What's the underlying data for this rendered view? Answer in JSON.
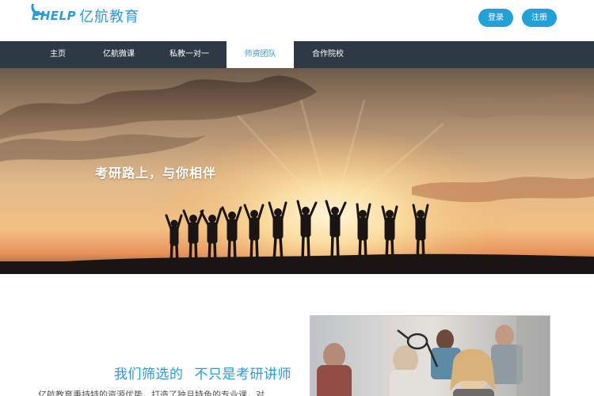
{
  "header": {
    "logo_mark": "EHELP",
    "logo_text": "亿航教育",
    "login_label": "登录",
    "register_label": "注册"
  },
  "nav": {
    "items": [
      {
        "label": "主页"
      },
      {
        "label": "亿航微课"
      },
      {
        "label": "私教一对一"
      },
      {
        "label": "师资团队"
      },
      {
        "label": "合作院校"
      }
    ],
    "active_index": 3
  },
  "banner": {
    "caption": "考研路上，与你相伴"
  },
  "content": {
    "title_part1": "我们筛选的",
    "title_part2": "不只是考研讲师",
    "body_text": "亿航教育秉持特的资源优势，打造了独且特色的专业课，对"
  },
  "colors": {
    "accent": "#22a1d9",
    "nav_bg": "#2d3a46"
  }
}
